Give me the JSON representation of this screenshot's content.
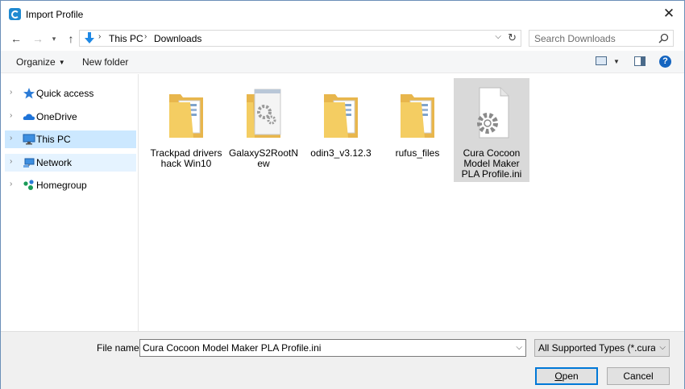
{
  "window": {
    "title": "Import Profile"
  },
  "nav": {
    "path": [
      "This PC",
      "Downloads"
    ],
    "search_placeholder": "Search Downloads"
  },
  "toolbar": {
    "organize_label": "Organize",
    "new_folder_label": "New folder"
  },
  "sidebar": {
    "items": [
      {
        "label": "Quick access",
        "icon": "star-icon"
      },
      {
        "label": "OneDrive",
        "icon": "cloud-icon"
      },
      {
        "label": "This PC",
        "icon": "computer-icon",
        "state": "selected"
      },
      {
        "label": "Network",
        "icon": "network-icon",
        "state": "hover"
      },
      {
        "label": "Homegroup",
        "icon": "homegroup-icon"
      }
    ]
  },
  "files": [
    {
      "name": "Trackpad drivers hack Win10",
      "icon": "folder-icon"
    },
    {
      "name": "GalaxyS2RootNew",
      "icon": "folder-settings-icon"
    },
    {
      "name": "odin3_v3.12.3",
      "icon": "folder-icon"
    },
    {
      "name": "rufus_files",
      "icon": "folder-icon"
    },
    {
      "name": "Cura Cocoon Model Maker PLA Profile.ini",
      "icon": "ini-file-icon",
      "selected": true
    }
  ],
  "footer": {
    "file_name_label": "File name:",
    "file_name_value": "Cura Cocoon Model Maker PLA Profile.ini",
    "file_type_value": "All Supported Types (*.curaprofile",
    "open_label_first": "O",
    "open_label_rest": "pen",
    "cancel_label": "Cancel"
  },
  "colors": {
    "selection": "#cce8ff",
    "hover": "#e5f3ff",
    "folder": "#f4cd62",
    "accent": "#0078d7"
  }
}
